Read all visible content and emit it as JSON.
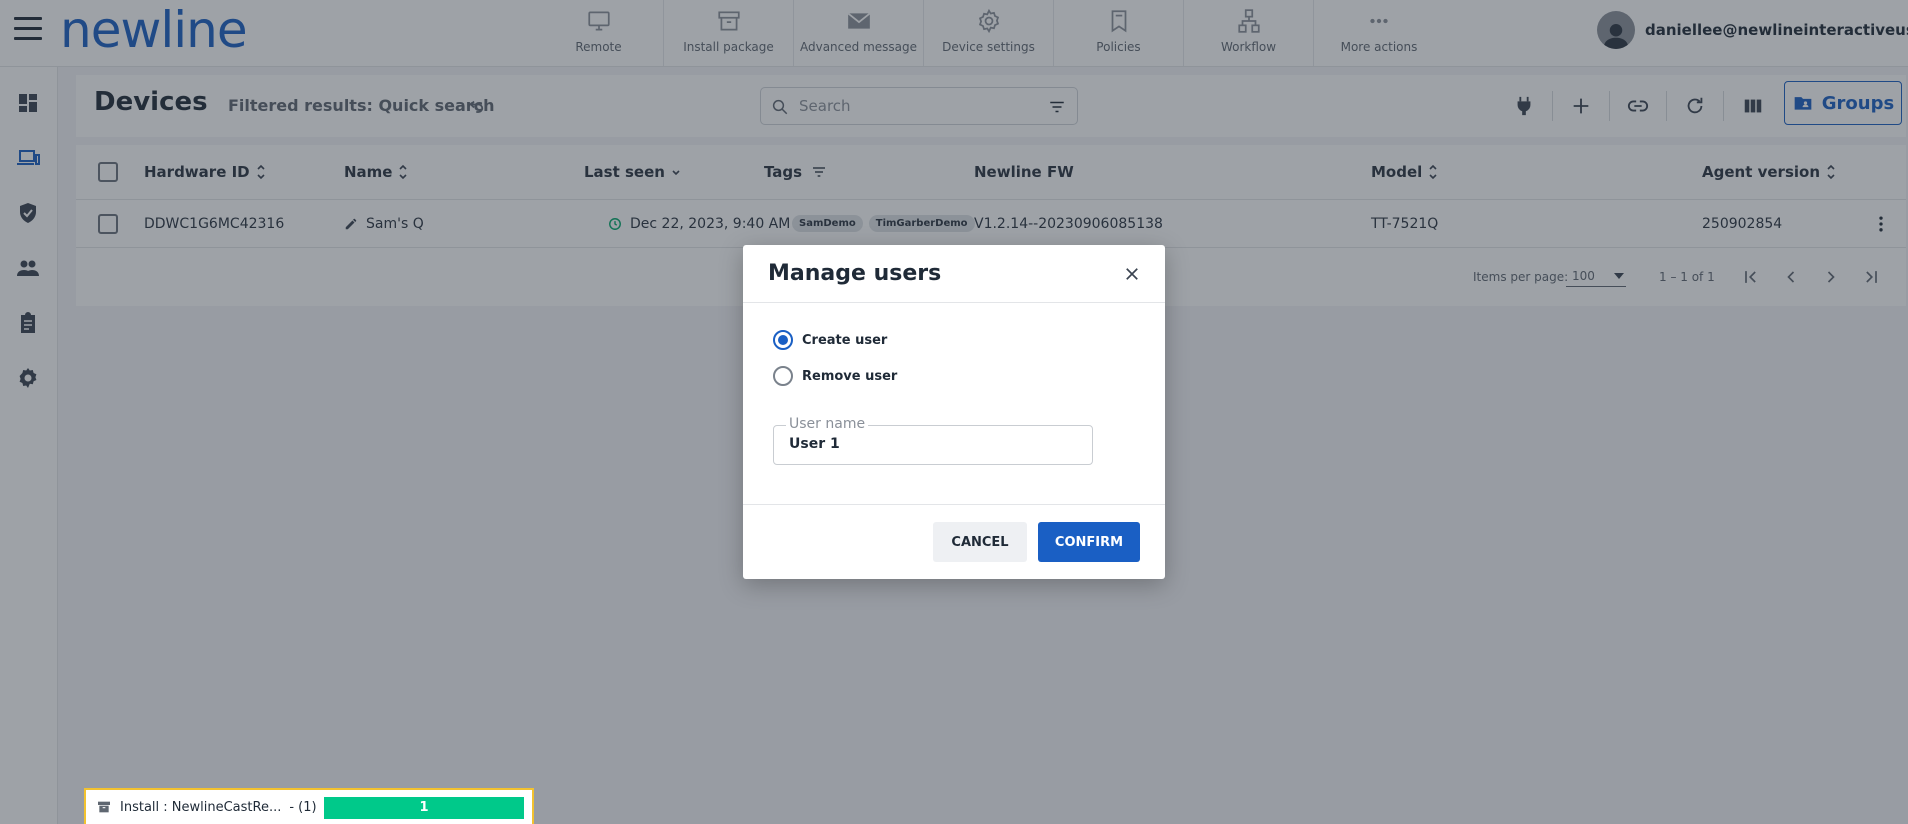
{
  "app": {
    "logo_text": "newline",
    "brand_color": "#1a5fc4"
  },
  "header_actions": [
    {
      "label": "Remote",
      "icon": "monitor-icon"
    },
    {
      "label": "Install package",
      "icon": "package-icon"
    },
    {
      "label": "Advanced message",
      "icon": "envelope-icon"
    },
    {
      "label": "Device settings",
      "icon": "gear-icon"
    },
    {
      "label": "Policies",
      "icon": "bookmark-icon"
    },
    {
      "label": "Workflow",
      "icon": "workflow-icon"
    },
    {
      "label": "More actions",
      "icon": "more-icon"
    }
  ],
  "user": {
    "email": "daniellee@newlineinteractiveus"
  },
  "sidebar": {
    "items": [
      {
        "name": "dashboard",
        "icon": "dashboard-icon"
      },
      {
        "name": "devices",
        "icon": "devices-icon",
        "active": true
      },
      {
        "name": "security",
        "icon": "shield-icon"
      },
      {
        "name": "users",
        "icon": "people-icon"
      },
      {
        "name": "reports",
        "icon": "clipboard-icon"
      },
      {
        "name": "settings",
        "icon": "gear-icon"
      }
    ]
  },
  "page": {
    "title": "Devices",
    "filter_note": "Filtered results: Quick search",
    "search_placeholder": "Search",
    "groups_label": "Groups"
  },
  "table": {
    "columns": [
      "Hardware ID",
      "Name",
      "Last seen",
      "Tags",
      "Newline FW",
      "Model",
      "Agent version"
    ],
    "rows": [
      {
        "hardware_id": "DDWC1G6MC42316",
        "name": "Sam's Q",
        "last_seen": "Dec 22, 2023, 9:40 AM",
        "tags": [
          "SamDemo",
          "TimGarberDemo"
        ],
        "firmware": "V1.2.14--20230906085138",
        "model": "TT-7521Q",
        "agent_version": "250902854"
      }
    ],
    "pager": {
      "items_per_page_label": "Items per page:",
      "items_per_page": "100",
      "range": "1 – 1 of 1"
    }
  },
  "modal": {
    "title": "Manage users",
    "options": [
      {
        "label": "Create user",
        "selected": true
      },
      {
        "label": "Remove user",
        "selected": false
      }
    ],
    "field_label": "User name",
    "field_value": "User 1",
    "cancel_label": "CANCEL",
    "confirm_label": "CONFIRM"
  },
  "install": {
    "text": "Install : NewlineCastRe...",
    "count_text": "- (1)",
    "progress_value": "1",
    "progress_fraction": 1.0,
    "progress_color": "#00c98a"
  }
}
